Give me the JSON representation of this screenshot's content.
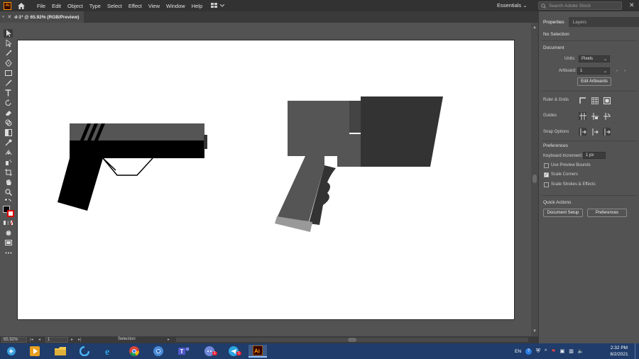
{
  "app": {
    "logo_text": "Ai"
  },
  "menubar": {
    "items": [
      "File",
      "Edit",
      "Object",
      "Type",
      "Select",
      "Effect",
      "View",
      "Window",
      "Help"
    ],
    "workspace": "Essentials",
    "search_placeholder": "Search Adobe Stock"
  },
  "document": {
    "tab_title": "d-1* @ 65.92% (RGB/Preview)"
  },
  "statusbar": {
    "zoom": "65.92%",
    "artboard": "1",
    "tool": "Selection"
  },
  "panel": {
    "tabs": [
      "Properties",
      "Layers"
    ],
    "selection": "No Selection",
    "document_header": "Document",
    "units_label": "Units:",
    "units_value": "Pixels",
    "artboard_label": "Artboard:",
    "artboard_value": "1",
    "edit_artboards": "Edit Artboards",
    "rulers_grids": "Ruler & Grids",
    "guides": "Guides",
    "snap_options": "Snap Options",
    "preferences_header": "Preferences",
    "keyboard_increment_label": "Keyboard Increment:",
    "keyboard_increment_value": "1 px",
    "use_preview_bounds": "Use Preview Bounds",
    "scale_corners": "Scale Corners",
    "scale_strokes": "Scale Strokes & Effects",
    "checks": {
      "use_preview_bounds": false,
      "scale_corners": true,
      "scale_strokes": false
    },
    "quick_actions": "Quick Actions",
    "document_setup": "Document Setup",
    "preferences_btn": "Preferences"
  },
  "taskbar": {
    "language": "EN",
    "time": "2:32 PM",
    "date": "8/2/2021",
    "badge_discord": "1",
    "badge_telegram": "1"
  },
  "colors": {
    "accent_orange": "#ff9a00",
    "taskbar": "#1f3c6b",
    "panel_bg": "#535353",
    "shape_dark": "#333333",
    "shape_mid": "#555555"
  }
}
